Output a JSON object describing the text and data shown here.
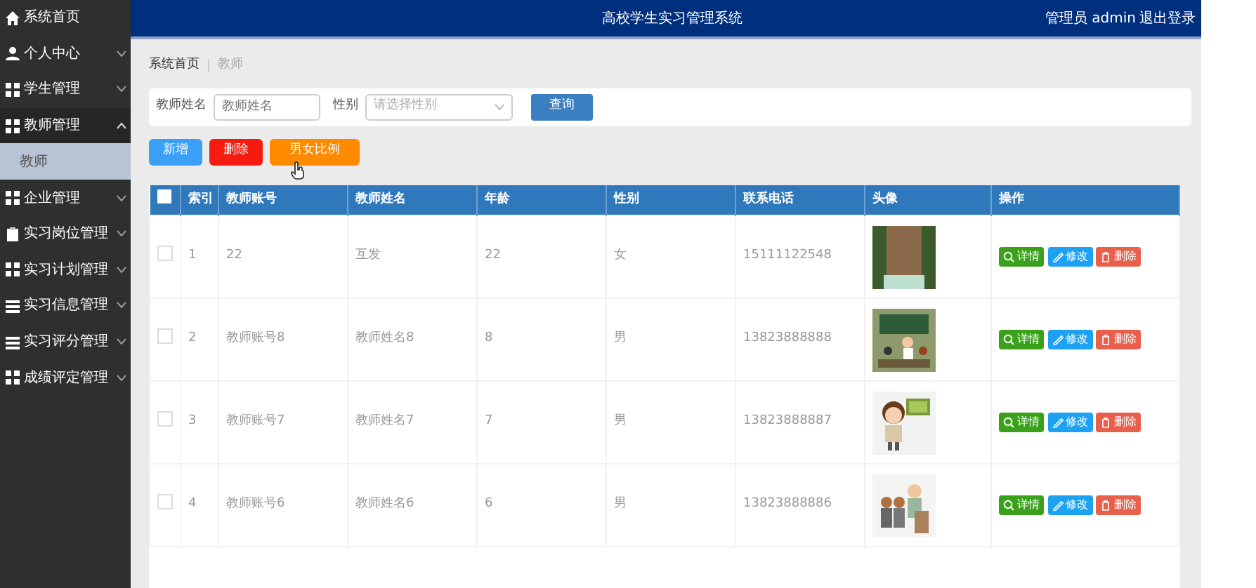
{
  "sidebar": {
    "items": [
      {
        "label": "系统首页",
        "kind": "link"
      },
      {
        "label": "个人中心",
        "kind": "menu",
        "expanded": false
      },
      {
        "label": "学生管理",
        "kind": "menu",
        "expanded": false
      },
      {
        "label": "教师管理",
        "kind": "menu",
        "expanded": true,
        "children": [
          {
            "label": "教师",
            "selected": true
          }
        ]
      },
      {
        "label": "企业管理",
        "kind": "menu",
        "expanded": false
      },
      {
        "label": "实习岗位管理",
        "kind": "menu",
        "expanded": false
      },
      {
        "label": "实习计划管理",
        "kind": "menu",
        "expanded": false
      },
      {
        "label": "实习信息管理",
        "kind": "menu",
        "expanded": false
      },
      {
        "label": "实习评分管理",
        "kind": "menu",
        "expanded": false
      },
      {
        "label": "成绩评定管理",
        "kind": "menu",
        "expanded": false
      }
    ]
  },
  "header": {
    "title": "高校学生实习管理系统",
    "user": "管理员 admin",
    "logout": "退出登录"
  },
  "breadcrumb": [
    "系统首页",
    "教师"
  ],
  "search": {
    "fields": [
      {
        "label": "教师姓名",
        "placeholder": "教师姓名",
        "kind": "text"
      },
      {
        "label": "性别",
        "placeholder": "请选择性别",
        "kind": "select"
      }
    ],
    "button": "查询"
  },
  "actions": [
    {
      "label": "新增",
      "kind": "add"
    },
    {
      "label": "删除",
      "kind": "delete"
    },
    {
      "label": "男女比例",
      "kind": "chart"
    }
  ],
  "table": {
    "select_all_checked": false,
    "columns": [
      "索引",
      "教师账号",
      "教师姓名",
      "年龄",
      "性别",
      "联系电话",
      "头像",
      "操作"
    ],
    "rows": [
      {
        "checked": false,
        "index": "1",
        "account": "22",
        "name": "互发",
        "age": "22",
        "gender": "女",
        "phone": "15111122548",
        "buttons": [
          {
            "label": "详情",
            "kind": "detail"
          },
          {
            "label": "修改",
            "kind": "edit"
          },
          {
            "label": "删除",
            "kind": "delete"
          }
        ]
      },
      {
        "checked": false,
        "index": "2",
        "account": "教师账号8",
        "name": "教师姓名8",
        "age": "8",
        "gender": "男",
        "phone": "13823888888",
        "buttons": [
          {
            "label": "详情",
            "kind": "detail"
          },
          {
            "label": "修改",
            "kind": "edit"
          },
          {
            "label": "删除",
            "kind": "delete"
          }
        ]
      },
      {
        "checked": false,
        "index": "3",
        "account": "教师账号7",
        "name": "教师姓名7",
        "age": "7",
        "gender": "男",
        "phone": "13823888887",
        "buttons": [
          {
            "label": "详情",
            "kind": "detail"
          },
          {
            "label": "修改",
            "kind": "edit"
          },
          {
            "label": "删除",
            "kind": "delete"
          }
        ]
      },
      {
        "checked": false,
        "index": "4",
        "account": "教师账号6",
        "name": "教师姓名6",
        "age": "6",
        "gender": "男",
        "phone": "13823888886",
        "buttons": [
          {
            "label": "详情",
            "kind": "detail"
          },
          {
            "label": "修改",
            "kind": "edit"
          },
          {
            "label": "删除",
            "kind": "delete"
          }
        ]
      }
    ]
  }
}
